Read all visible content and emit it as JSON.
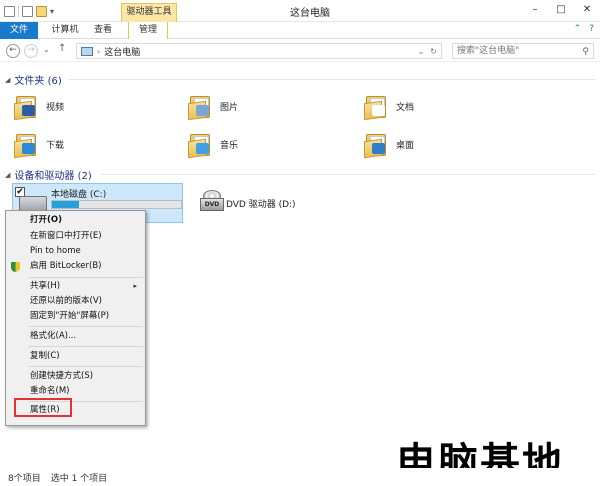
{
  "titlebar": {
    "context_tab": "驱动器工具",
    "title": "这台电脑",
    "minimize": "–",
    "maximize": "□",
    "close": "✕"
  },
  "ribbon": {
    "tabs": [
      "文件",
      "计算机",
      "查看",
      "管理"
    ],
    "collapse": "⌃",
    "help": "?"
  },
  "address": {
    "back": "←",
    "forward": "→",
    "history": "⌄",
    "up": "↑",
    "chevron": "›",
    "path": "这台电脑",
    "dropdown": "⌄",
    "refresh": "↻",
    "search_placeholder": "搜索\"这台电脑\"",
    "search_icon": "⚲"
  },
  "folders_group": {
    "header": "文件夹 (6)",
    "items": [
      {
        "label": "视频",
        "badge_color": "#2b5ea8"
      },
      {
        "label": "图片",
        "badge_color": "#7aa6d6"
      },
      {
        "label": "文档",
        "badge_color": "#ffffff"
      },
      {
        "label": "下载",
        "badge_color": "#2a8ad8"
      },
      {
        "label": "音乐",
        "badge_color": "#3da1e3"
      },
      {
        "label": "桌面",
        "badge_color": "#2f7fc9"
      }
    ]
  },
  "devices_group": {
    "header": "设备和驱动器 (2)",
    "local_disk": {
      "name": "本地磁盘 (C:)",
      "usage_fraction": 0.21,
      "size_text": "B"
    },
    "dvd": {
      "name": "DVD 驱动器 (D:)",
      "label": "DVD"
    }
  },
  "context_menu": {
    "items": [
      {
        "label": "打开(O)",
        "bold": true
      },
      {
        "label": "在新窗口中打开(E)"
      },
      {
        "label": "Pin to home"
      },
      {
        "label": "启用 BitLocker(B)"
      },
      {
        "label": "共享(H)",
        "arrow": "▸"
      },
      {
        "label": "还原以前的版本(V)"
      },
      {
        "label": "固定到\"开始\"屏幕(P)"
      },
      {
        "label": "格式化(A)..."
      },
      {
        "label": "复制(C)"
      },
      {
        "label": "创建快捷方式(S)"
      },
      {
        "label": "重命名(M)"
      },
      {
        "label": "属性(R)"
      }
    ]
  },
  "watermark": "电脑基地",
  "statusbar": {
    "item_count": "8个项目",
    "selected": "选中 1 个项目"
  }
}
